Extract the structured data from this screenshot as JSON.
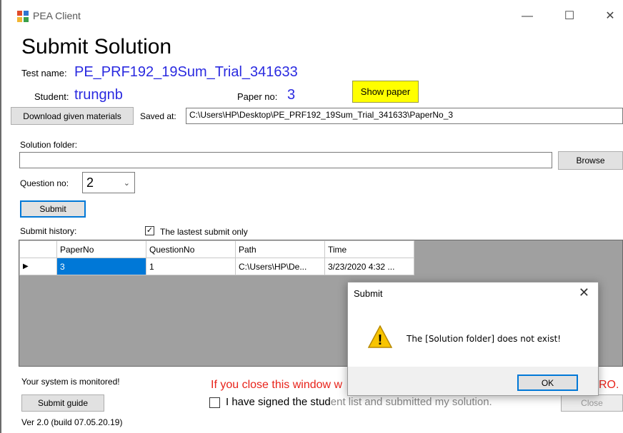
{
  "window": {
    "title": "PEA Client",
    "minimize": "—",
    "maximize": "☐",
    "close": "✕"
  },
  "heading": "Submit Solution",
  "test": {
    "label": "Test name:",
    "value": "PE_PRF192_19Sum_Trial_341633"
  },
  "student": {
    "label": "Student:",
    "value": "trungnb"
  },
  "paper": {
    "label": "Paper no:",
    "value": "3"
  },
  "buttons": {
    "show_paper": "Show paper",
    "download": "Download given materials",
    "browse": "Browse",
    "submit": "Submit",
    "submit_guide": "Submit guide",
    "ok": "OK"
  },
  "saved_at": {
    "label": "Saved at:",
    "value": "C:\\Users\\HP\\Desktop\\PE_PRF192_19Sum_Trial_341633\\PaperNo_3"
  },
  "solution_folder": {
    "label": "Solution folder:",
    "value": ""
  },
  "question": {
    "label": "Question no:",
    "value": "2"
  },
  "history": {
    "label": "Submit history:",
    "latest_only_label": "The lastest submit only",
    "latest_only_checked": true,
    "columns": [
      "PaperNo",
      "QuestionNo",
      "Path",
      "Time"
    ],
    "rows": [
      {
        "PaperNo": "3",
        "QuestionNo": "1",
        "Path": "C:\\Users\\HP\\De...",
        "Time": "3/23/2020 4:32 ..."
      }
    ],
    "row_marker": "▶"
  },
  "status": {
    "monitored": "Your system is monitored!",
    "warning_visible_start": "If you close this window w",
    "warning_visible_end": "RO.",
    "signed_label": "I have signed the stud",
    "signed_label_end": "ent list and submitted my solution.",
    "version": "Ver 2.0 (build 07.05.20.19)",
    "close_button_partial": "Close"
  },
  "dialog": {
    "title": "Submit",
    "message": "The [Solution folder] does not exist!",
    "close": "✕",
    "warning_icon_glyph": "!"
  },
  "colors": {
    "accent_blue": "#2a2ae0",
    "selection": "#0078d7",
    "warning_red": "#e8231a",
    "highlight_yellow": "#ffff00"
  }
}
